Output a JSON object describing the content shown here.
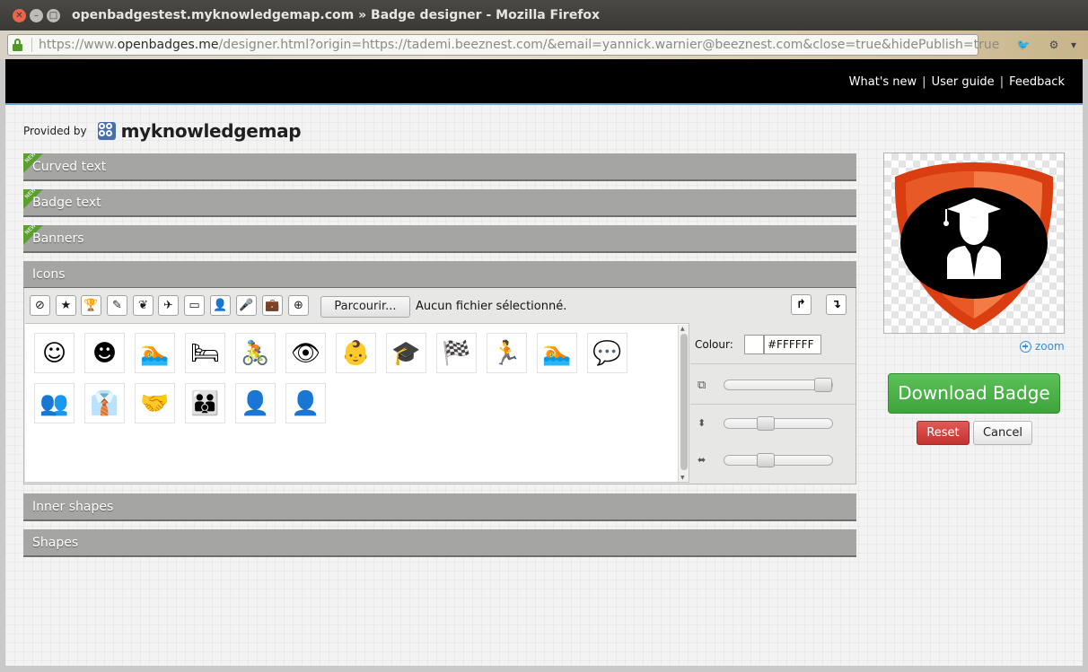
{
  "window": {
    "title": "openbadgestest.myknowledgemap.com » Badge designer - Mozilla Firefox",
    "url_prefix": "https://www.",
    "url_domain": "openbadges.me",
    "url_rest": "/designer.html?origin=https://tademi.beeznest.com/&email=yannick.warnier@beeznest.com&close=true&hidePublish=true"
  },
  "nav": {
    "whats_new": "What's new",
    "user_guide": "User guide",
    "feedback": "Feedback",
    "separator": "|"
  },
  "provider": {
    "label": "Provided by",
    "name": "myknowledgemap"
  },
  "accordion": {
    "new_tag": "NEW",
    "curved_text": "Curved text",
    "badge_text": "Badge text",
    "banners": "Banners",
    "icons": "Icons",
    "inner_shapes": "Inner shapes",
    "shapes": "Shapes"
  },
  "icons_panel": {
    "categories": [
      "⊘",
      "★",
      "🏆",
      "✎",
      "❦",
      "✈",
      "▭",
      "👤",
      "🎤",
      "💼",
      "⊕"
    ],
    "browse_label": "Parcourir...",
    "no_file": "Aucun fichier sélectionné.",
    "up_arrow": "↱",
    "down_arrow": "↴",
    "icons": [
      "☺",
      "☻",
      "🏊",
      "🛏",
      "🚴",
      "👁",
      "👶",
      "🎓",
      "🏁",
      "🏃",
      "🏊",
      "💬",
      "👥",
      "👔",
      "🤝",
      "👪",
      "👤",
      "👤"
    ]
  },
  "props": {
    "colour_label": "Colour:",
    "colour_hex": "#FFFFFF",
    "colour": "#FFFFFF"
  },
  "actions": {
    "zoom": "zoom",
    "download": "Download Badge",
    "reset": "Reset",
    "cancel": "Cancel"
  },
  "colors": {
    "accent_green": "#3fa33c",
    "reset_red": "#c5322f",
    "header_black": "#000000",
    "shield_outer": "#d93d10",
    "shield_inner": "#f47a46"
  }
}
